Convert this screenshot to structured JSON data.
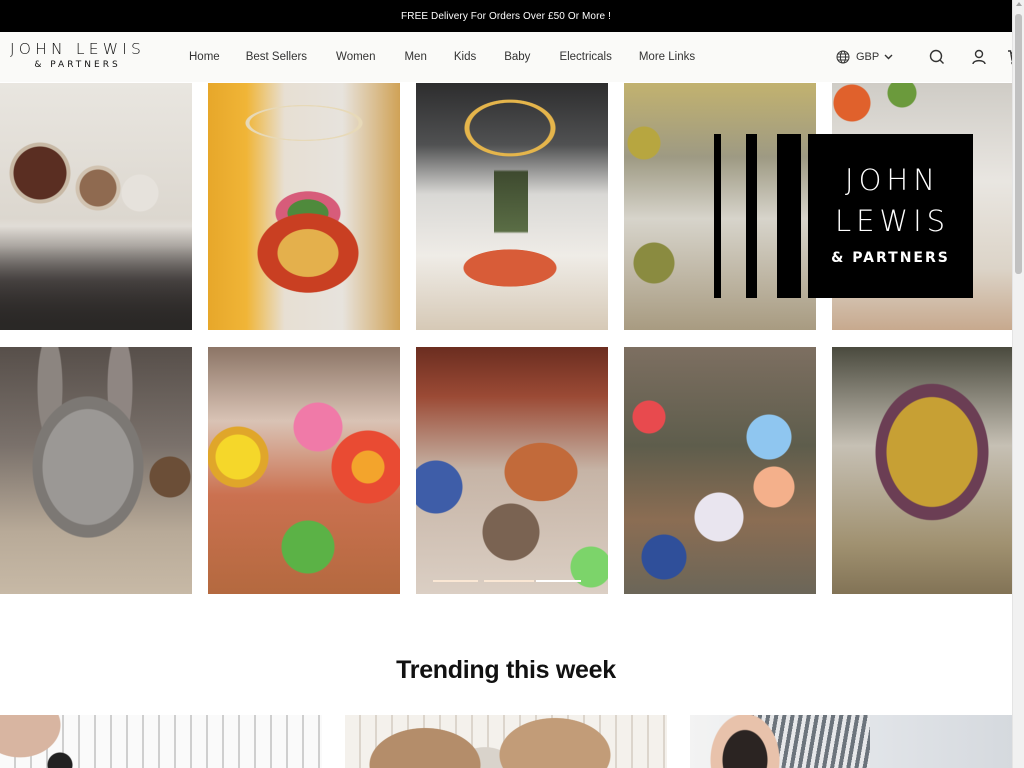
{
  "announcement": {
    "text": "FREE Delivery For Orders Over £50 Or More !"
  },
  "brand": {
    "logo_line1": "JOHN LEWIS",
    "logo_line2": "& PARTNERS"
  },
  "nav": {
    "items": [
      {
        "label": "Home"
      },
      {
        "label": "Best Sellers"
      },
      {
        "label": "Women"
      },
      {
        "label": "Men"
      },
      {
        "label": "Kids"
      },
      {
        "label": "Baby"
      },
      {
        "label": "Electricals"
      },
      {
        "label": "More Links"
      }
    ]
  },
  "header_actions": {
    "currency": "GBP",
    "currency_icon": "globe-icon",
    "search_icon": "search-icon",
    "account_icon": "user-icon",
    "cart_icon": "cart-icon"
  },
  "gallery": {
    "tiles": [
      {
        "alt": "Decorative woven discs on a shelf"
      },
      {
        "alt": "Floral display stand under ring light"
      },
      {
        "alt": "Tree display under gold ring light"
      },
      {
        "alt": "Hanging ornaments on branches"
      },
      {
        "alt": "Store interior with leaf decorations"
      },
      {
        "alt": "Hare sculpture"
      },
      {
        "alt": "Colourful paper flowers"
      },
      {
        "alt": "Fox and hedgehog figures"
      },
      {
        "alt": "Spiky pom-pom decorations with bees"
      },
      {
        "alt": "Gold egg nest ornament"
      }
    ],
    "brand_overlay": {
      "line1": "JOHN",
      "line2": "LEWIS",
      "line3": "& PARTNERS"
    },
    "carousel": {
      "slides": 3,
      "active_index": 2
    }
  },
  "trending": {
    "title": "Trending this week",
    "cards": [
      {
        "alt": "Striped bedding product"
      },
      {
        "alt": "Cushions on sofa"
      },
      {
        "alt": "Person relaxing with striped pillow"
      }
    ]
  }
}
